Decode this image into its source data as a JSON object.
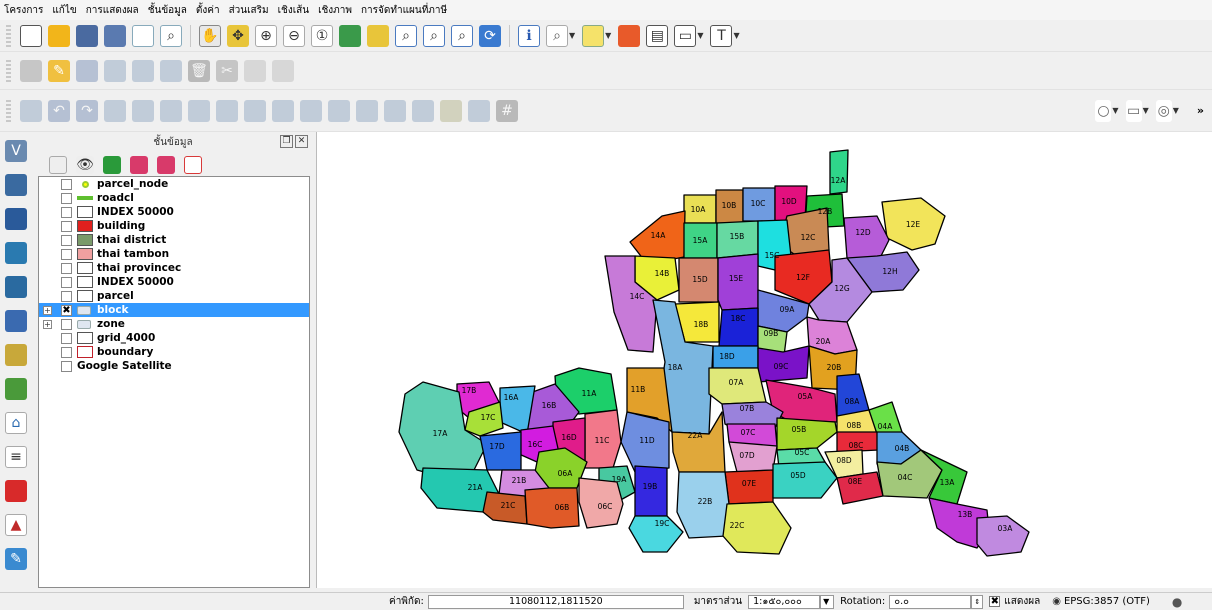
{
  "menu": [
    "โครงการ",
    "แก้ไข",
    "การแสดงผล",
    "ชั้นข้อมูล",
    "ตั้งค่า",
    "ส่วนเสริม",
    "เชิงเส้น",
    "เชิงภาพ",
    "การจัดทำแผนที่ภาษี"
  ],
  "panel": {
    "title": "ชั้นข้อมูล"
  },
  "layers": [
    {
      "name": "parcel_node",
      "symbol": "point",
      "color": "#9acd32",
      "checked": false
    },
    {
      "name": "roadcl",
      "symbol": "line",
      "color": "#5fbf2f",
      "checked": false
    },
    {
      "name": "INDEX 50000",
      "symbol": "fill",
      "color": "#ffffff",
      "checked": false
    },
    {
      "name": "building",
      "symbol": "fill",
      "color": "#e0201e",
      "checked": false
    },
    {
      "name": "thai district",
      "symbol": "fill",
      "color": "#7a9a6a",
      "checked": false
    },
    {
      "name": "thai tambon",
      "symbol": "fill",
      "color": "#f0a0a0",
      "checked": false
    },
    {
      "name": "thai provincec",
      "symbol": "fill",
      "color": "#ffffff",
      "checked": false
    },
    {
      "name": "INDEX 50000",
      "symbol": "fill",
      "color": "#ffffff",
      "checked": false
    },
    {
      "name": "parcel",
      "symbol": "fill",
      "color": "#ffffff",
      "checked": false
    },
    {
      "name": "block",
      "symbol": "group",
      "color": "#dfe6f0",
      "checked": true,
      "selected": true,
      "expand": "+"
    },
    {
      "name": "zone",
      "symbol": "group",
      "color": "#dfe6f0",
      "checked": false,
      "expand": "+"
    },
    {
      "name": "grid_4000",
      "symbol": "fill",
      "color": "#ffffff",
      "checked": false
    },
    {
      "name": "boundary",
      "symbol": "fill",
      "color": "#ffffff",
      "border": "#c0202a",
      "checked": false
    },
    {
      "name": "Google Satellite",
      "symbol": "none",
      "checked": false
    }
  ],
  "map_blocks": [
    {
      "id": "12A",
      "fill": "#2fd68a"
    },
    {
      "id": "10A",
      "fill": "#e9df55"
    },
    {
      "id": "10B",
      "fill": "#cc8844"
    },
    {
      "id": "10C",
      "fill": "#6f9be0"
    },
    {
      "id": "10D",
      "fill": "#e3107e"
    },
    {
      "id": "12B",
      "fill": "#1fbf3a"
    },
    {
      "id": "12E",
      "fill": "#f2e45a"
    },
    {
      "id": "14A",
      "fill": "#f06418"
    },
    {
      "id": "15A",
      "fill": "#3fd486"
    },
    {
      "id": "15B",
      "fill": "#66d9a2"
    },
    {
      "id": "12C",
      "fill": "#c98a55"
    },
    {
      "id": "12D",
      "fill": "#b65cd8"
    },
    {
      "id": "15C",
      "fill": "#1edfe0"
    },
    {
      "id": "12H",
      "fill": "#8f79d8"
    },
    {
      "id": "14B",
      "fill": "#e9f038"
    },
    {
      "id": "15D",
      "fill": "#d48870"
    },
    {
      "id": "15E",
      "fill": "#a040d8"
    },
    {
      "id": "12F",
      "fill": "#e82a22"
    },
    {
      "id": "12G",
      "fill": "#b48ae0"
    },
    {
      "id": "14C",
      "fill": "#c77ad8"
    },
    {
      "id": "09A",
      "fill": "#6f82de"
    },
    {
      "id": "18B",
      "fill": "#f5e83a"
    },
    {
      "id": "18C",
      "fill": "#1a22d8"
    },
    {
      "id": "09B",
      "fill": "#a7e07a"
    },
    {
      "id": "20A",
      "fill": "#dc82d8"
    },
    {
      "id": "18D",
      "fill": "#3aa0e8"
    },
    {
      "id": "18A",
      "fill": "#7ab6e0"
    },
    {
      "id": "09C",
      "fill": "#7a12c8"
    },
    {
      "id": "20B",
      "fill": "#e2a11f"
    },
    {
      "id": "07A",
      "fill": "#dfe87a"
    },
    {
      "id": "05A",
      "fill": "#e0247a"
    },
    {
      "id": "08A",
      "fill": "#2246d8"
    },
    {
      "id": "11B",
      "fill": "#e2a02a"
    },
    {
      "id": "11A",
      "fill": "#1ccf6a"
    },
    {
      "id": "16B",
      "fill": "#a85ad8"
    },
    {
      "id": "16A",
      "fill": "#4ab8e8"
    },
    {
      "id": "17B",
      "fill": "#e02ad2"
    },
    {
      "id": "17C",
      "fill": "#a8e038"
    },
    {
      "id": "17A",
      "fill": "#5ecfb2"
    },
    {
      "id": "07B",
      "fill": "#9a82dc"
    },
    {
      "id": "08B",
      "fill": "#f5e26a"
    },
    {
      "id": "04A",
      "fill": "#6ae048"
    },
    {
      "id": "07C",
      "fill": "#d24ad8"
    },
    {
      "id": "05B",
      "fill": "#a4d62a"
    },
    {
      "id": "08C",
      "fill": "#e82a3a"
    },
    {
      "id": "04B",
      "fill": "#5aa0e0"
    },
    {
      "id": "11D",
      "fill": "#6e8ee0"
    },
    {
      "id": "22A",
      "fill": "#e0a83a"
    },
    {
      "id": "11C",
      "fill": "#f2788a"
    },
    {
      "id": "16D",
      "fill": "#e01c8a"
    },
    {
      "id": "16C",
      "fill": "#d21ce0"
    },
    {
      "id": "17D",
      "fill": "#2a6ae0"
    },
    {
      "id": "07D",
      "fill": "#e2a0d0"
    },
    {
      "id": "05C",
      "fill": "#5adca8"
    },
    {
      "id": "08D",
      "fill": "#f3eea0"
    },
    {
      "id": "06A",
      "fill": "#8ad22a"
    },
    {
      "id": "19A",
      "fill": "#48c8a0"
    },
    {
      "id": "19B",
      "fill": "#3428e0"
    },
    {
      "id": "07E",
      "fill": "#e0321c"
    },
    {
      "id": "05D",
      "fill": "#3ad2c2"
    },
    {
      "id": "08E",
      "fill": "#e02a4a"
    },
    {
      "id": "04C",
      "fill": "#a2c87a"
    },
    {
      "id": "13A",
      "fill": "#38c83a"
    },
    {
      "id": "21B",
      "fill": "#d48ce0"
    },
    {
      "id": "21A",
      "fill": "#24c8b0"
    },
    {
      "id": "21C",
      "fill": "#c85a28"
    },
    {
      "id": "06B",
      "fill": "#e05a28"
    },
    {
      "id": "06C",
      "fill": "#f0a8a8"
    },
    {
      "id": "22B",
      "fill": "#9ad0ec"
    },
    {
      "id": "19C",
      "fill": "#4ad8e0"
    },
    {
      "id": "22C",
      "fill": "#e0e85a"
    },
    {
      "id": "13B",
      "fill": "#c03ad8"
    },
    {
      "id": "03A",
      "fill": "#c08ae0"
    }
  ],
  "status": {
    "coord_label": "ค่าพิกัด:",
    "coord_value": "11080112,1811520",
    "scale_label": "มาตราส่วน",
    "scale_value": "1:๑๕๐,๐๐๐",
    "rotation_label": "Rotation:",
    "rotation_value": "๐.๐",
    "render_label": "แสดงผล",
    "crs": "EPSG:3857 (OTF)"
  }
}
